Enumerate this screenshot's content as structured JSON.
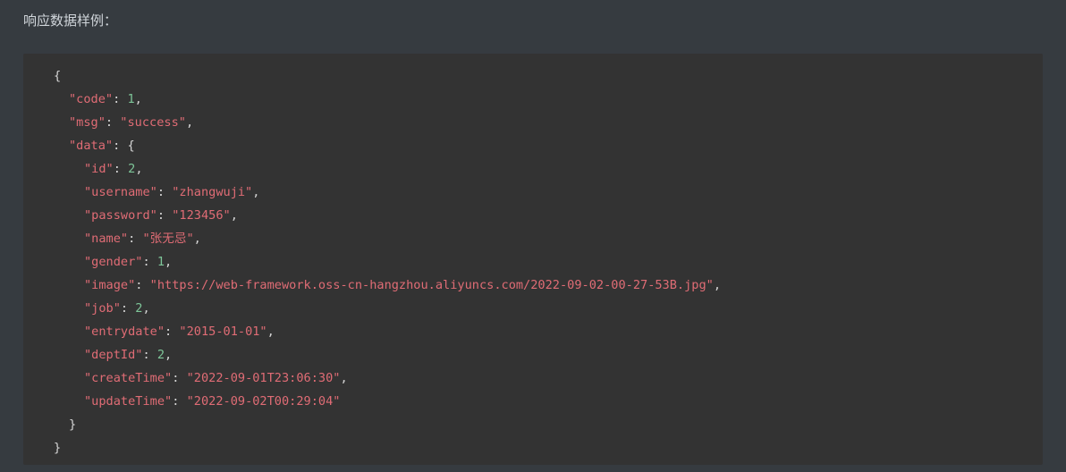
{
  "heading": "响应数据样例：",
  "json": {
    "open_brace": "{",
    "close_brace": "}",
    "code": {
      "key": "\"code\"",
      "value": "1"
    },
    "msg": {
      "key": "\"msg\"",
      "value": "\"success\""
    },
    "data": {
      "key": "\"data\"",
      "open": "{",
      "close": "}",
      "fields": {
        "id": {
          "key": "\"id\"",
          "value": "2"
        },
        "username": {
          "key": "\"username\"",
          "value": "\"zhangwuji\""
        },
        "password": {
          "key": "\"password\"",
          "value": "\"123456\""
        },
        "name": {
          "key": "\"name\"",
          "value": "\"张无忌\""
        },
        "gender": {
          "key": "\"gender\"",
          "value": "1"
        },
        "image": {
          "key": "\"image\"",
          "value": "\"https://web-framework.oss-cn-hangzhou.aliyuncs.com/2022-09-02-00-27-53B.jpg\""
        },
        "job": {
          "key": "\"job\"",
          "value": "2"
        },
        "entrydate": {
          "key": "\"entrydate\"",
          "value": "\"2015-01-01\""
        },
        "deptId": {
          "key": "\"deptId\"",
          "value": "2"
        },
        "createTime": {
          "key": "\"createTime\"",
          "value": "\"2022-09-01T23:06:30\""
        },
        "updateTime": {
          "key": "\"updateTime\"",
          "value": "\"2022-09-02T00:29:04\""
        }
      }
    }
  },
  "colors": {
    "background": "#363b40",
    "code_background": "#333333",
    "key_string": "#e06c75",
    "number": "#7ec699",
    "punctuation": "#d6d6d6"
  }
}
